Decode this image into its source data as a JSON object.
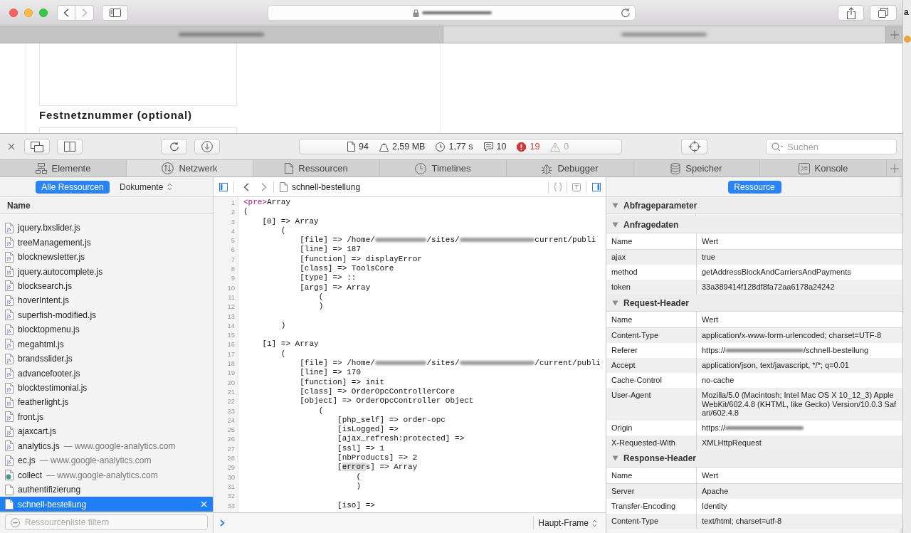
{
  "browser": {
    "tabs": [
      {
        "selected": false
      },
      {
        "selected": true
      }
    ],
    "side_window": {
      "text": "a"
    }
  },
  "page": {
    "heading": "Festnetznummer (optional)"
  },
  "devtools": {
    "stats": [
      {
        "kind": "resources",
        "text": "94"
      },
      {
        "kind": "size",
        "text": "2,59 MB"
      },
      {
        "kind": "time",
        "text": "1,77 s"
      },
      {
        "kind": "logs",
        "text": "10"
      },
      {
        "kind": "errors",
        "text": "19"
      },
      {
        "kind": "warnings",
        "text": "0"
      }
    ],
    "search": {
      "placeholder": "Suchen"
    },
    "tabs": [
      {
        "kind": "elements",
        "label": "Elemente",
        "selected": false
      },
      {
        "kind": "network",
        "label": "Netzwerk",
        "selected": true
      },
      {
        "kind": "resources",
        "label": "Ressourcen",
        "selected": false
      },
      {
        "kind": "timelines",
        "label": "Timelines",
        "selected": false
      },
      {
        "kind": "debugger",
        "label": "Debugger",
        "selected": false
      },
      {
        "kind": "storage",
        "label": "Speicher",
        "selected": false
      },
      {
        "kind": "console",
        "label": "Konsole",
        "selected": false
      }
    ],
    "sidebar": {
      "scope": [
        {
          "label": "Alle Ressourcen",
          "selected": true
        }
      ],
      "type_filter": "Dokumente",
      "column": "Name",
      "items": [
        {
          "kind": "script",
          "name": "jquery.bxslider.js",
          "selected": false
        },
        {
          "kind": "script",
          "name": "treeManagement.js",
          "selected": false
        },
        {
          "kind": "script",
          "name": "blocknewsletter.js",
          "selected": false
        },
        {
          "kind": "script",
          "name": "jquery.autocomplete.js",
          "selected": false
        },
        {
          "kind": "script",
          "name": "blocksearch.js",
          "selected": false
        },
        {
          "kind": "script",
          "name": "hoverIntent.js",
          "selected": false
        },
        {
          "kind": "script",
          "name": "superfish-modified.js",
          "selected": false
        },
        {
          "kind": "script",
          "name": "blocktopmenu.js",
          "selected": false
        },
        {
          "kind": "script",
          "name": "megahtml.js",
          "selected": false
        },
        {
          "kind": "script",
          "name": "brandsslider.js",
          "selected": false
        },
        {
          "kind": "script",
          "name": "advancefooter.js",
          "selected": false
        },
        {
          "kind": "script",
          "name": "blocktestimonial.js",
          "selected": false
        },
        {
          "kind": "script",
          "name": "featherlight.js",
          "selected": false
        },
        {
          "kind": "script",
          "name": "front.js",
          "selected": false
        },
        {
          "kind": "script",
          "name": "ajaxcart.js",
          "selected": false
        },
        {
          "kind": "script",
          "name": "analytics.js",
          "domain": "— www.google-analytics.com",
          "selected": false
        },
        {
          "kind": "script",
          "name": "ec.js",
          "domain": "— www.google-analytics.com",
          "selected": false
        },
        {
          "kind": "other",
          "name": "collect",
          "domain": "— www.google-analytics.com",
          "selected": false
        },
        {
          "kind": "document",
          "name": "authentifizierung",
          "selected": false
        },
        {
          "kind": "document",
          "name": "schnell-bestellung",
          "selected": true
        }
      ],
      "filter": {
        "placeholder": "Ressourcenliste filtern"
      }
    },
    "viewer": {
      "title": "schnell-bestellung",
      "lines": [
        {
          "number": "1",
          "parts": [
            {
              "kind": "tag",
              "text": "<pre>"
            },
            {
              "kind": "plain",
              "text": "Array"
            }
          ]
        },
        {
          "number": "2",
          "text": "("
        },
        {
          "number": "3",
          "text": "    [0] => Array"
        },
        {
          "number": "4",
          "text": "        ("
        },
        {
          "number": "5",
          "parts": [
            {
              "kind": "plain",
              "text": "            [file] => /home/"
            },
            {
              "kind": "redacted"
            },
            {
              "kind": "plain",
              "text": "/sites/"
            },
            {
              "kind": "redacted"
            },
            {
              "kind": "plain",
              "text": "current/publi"
            }
          ]
        },
        {
          "number": "6",
          "text": "            [line] => 187"
        },
        {
          "number": "7",
          "text": "            [function] => displayError"
        },
        {
          "number": "8",
          "text": "            [class] => ToolsCore"
        },
        {
          "number": "9",
          "text": "            [type] => ::"
        },
        {
          "number": "10",
          "text": "            [args] => Array"
        },
        {
          "number": "11",
          "text": "                ("
        },
        {
          "number": "12",
          "text": "                )"
        },
        {
          "number": "13"
        },
        {
          "number": "14",
          "text": "        )"
        },
        {
          "number": "15"
        },
        {
          "number": "16",
          "text": "    [1] => Array"
        },
        {
          "number": "17",
          "text": "        ("
        },
        {
          "number": "18",
          "parts": [
            {
              "kind": "plain",
              "text": "            [file] => /home/"
            },
            {
              "kind": "redacted"
            },
            {
              "kind": "plain",
              "text": "/sites/"
            },
            {
              "kind": "redacted"
            },
            {
              "kind": "plain",
              "text": "/current/publi"
            }
          ]
        },
        {
          "number": "19",
          "text": "            [line] => 170"
        },
        {
          "number": "20",
          "text": "            [function] => init"
        },
        {
          "number": "21",
          "text": "            [class] => OrderOpcControllerCore"
        },
        {
          "number": "22",
          "text": "            [object] => OrderOpcController Object"
        },
        {
          "number": "23",
          "text": "                ("
        },
        {
          "number": "24",
          "text": "                    [php_self] => order-opc"
        },
        {
          "number": "25",
          "text": "                    [isLogged] =>"
        },
        {
          "number": "26",
          "text": "                    [ajax_refresh:protected] =>"
        },
        {
          "number": "27",
          "text": "                    [ssl] => 1"
        },
        {
          "number": "28",
          "text": "                    [nbProducts] => 2"
        },
        {
          "number": "29",
          "parts": [
            {
              "kind": "plain",
              "text": "                    ["
            },
            {
              "kind": "match",
              "text": "error"
            },
            {
              "kind": "plain",
              "text": "s] => Array"
            }
          ]
        },
        {
          "number": "30",
          "text": "                        ("
        },
        {
          "number": "31",
          "text": "                        )"
        },
        {
          "number": "32"
        },
        {
          "number": "33",
          "text": "                    [iso] =>"
        }
      ]
    },
    "console": {
      "frame": "Haupt-Frame"
    },
    "details": {
      "button": "Ressource",
      "sections": [
        {
          "title": "Abfrageparameter",
          "expanded": true
        },
        {
          "title": "Anfragedaten",
          "expanded": true,
          "columns": [
            "Name",
            "Wert"
          ],
          "rows": [
            {
              "name": "ajax",
              "value": "true"
            },
            {
              "name": "method",
              "value": "getAddressBlockAndCarriersAndPayments"
            },
            {
              "name": "token",
              "value": "33a389414f128df8fa72aa6178a24242"
            }
          ]
        },
        {
          "title": "Request-Header",
          "expanded": true,
          "columns": [
            "Name",
            "Wert"
          ],
          "rows": [
            {
              "name": "Content-Type",
              "value": "application/x-www-form-urlencoded; charset=UTF-8"
            },
            {
              "name": "Referer",
              "value": [
                {
                  "kind": "text",
                  "text": "https://"
                },
                {
                  "kind": "redacted"
                },
                {
                  "kind": "text",
                  "text": "/schnell-bestellung"
                }
              ]
            },
            {
              "name": "Accept",
              "value": "application/json, text/javascript, */*; q=0.01"
            },
            {
              "name": "Cache-Control",
              "value": "no-cache"
            },
            {
              "name": "User-Agent",
              "value": "Mozilla/5.0 (Macintosh; Intel Mac OS X 10_12_3) AppleWebKit/602.4.8 (KHTML, like Gecko) Version/10.0.3 Safari/602.4.8"
            },
            {
              "name": "Origin",
              "value": [
                {
                  "kind": "text",
                  "text": "https://"
                },
                {
                  "kind": "redacted"
                }
              ]
            },
            {
              "name": "X-Requested-With",
              "value": "XMLHttpRequest"
            }
          ]
        },
        {
          "title": "Response-Header",
          "expanded": true,
          "columns": [
            "Name",
            "Wert"
          ],
          "rows": [
            {
              "name": "Server",
              "value": "Apache"
            },
            {
              "name": "Transfer-Encoding",
              "value": "Identity"
            },
            {
              "name": "Content-Type",
              "value": "text/html; charset=utf-8"
            }
          ]
        }
      ]
    }
  }
}
